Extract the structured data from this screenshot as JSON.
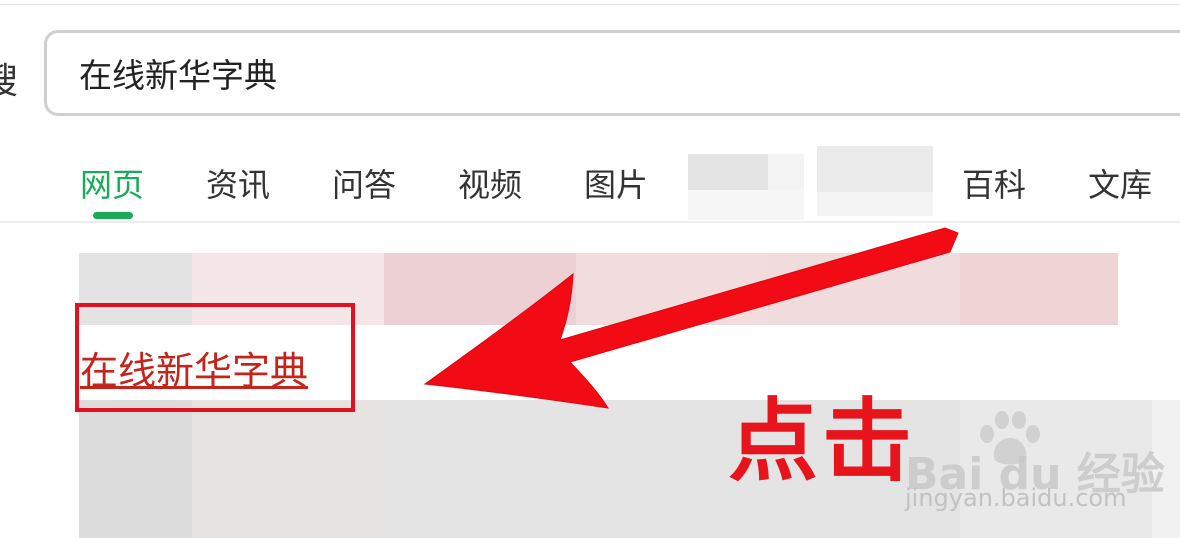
{
  "search": {
    "query": "在线新华字典",
    "partial_label": "搜"
  },
  "tabs": [
    {
      "label": "网页",
      "active": true
    },
    {
      "label": "资讯"
    },
    {
      "label": "问答"
    },
    {
      "label": "视频"
    },
    {
      "label": "图片"
    },
    {
      "label": "百科"
    },
    {
      "label": "文库"
    }
  ],
  "result": {
    "title": "在线新华字典"
  },
  "annotation": {
    "text": "点击"
  },
  "watermark": {
    "logo_text": "Bai du 经验",
    "url": "jingyan.baidu.com"
  },
  "colors": {
    "accent_green": "#1aab5a",
    "link_red": "#c3241c",
    "annotation_red": "#e8141c"
  }
}
